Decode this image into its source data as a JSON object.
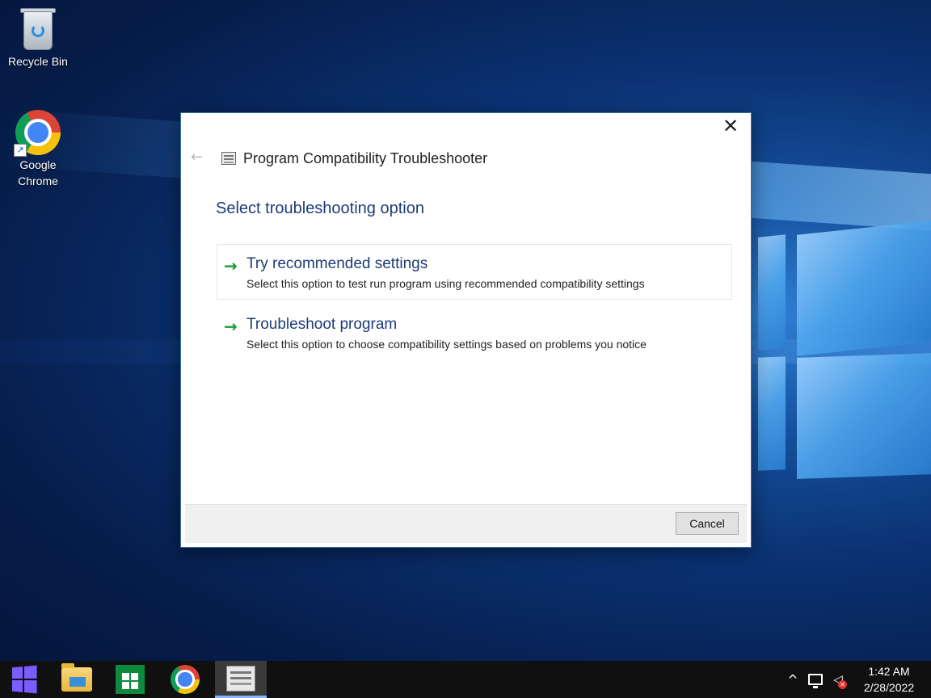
{
  "desktop": {
    "icons": [
      {
        "label": "Recycle Bin",
        "icon": "recycle-bin-icon"
      },
      {
        "label": "Google Chrome",
        "label_line1": "Google",
        "label_line2": "Chrome",
        "icon": "chrome-icon"
      }
    ]
  },
  "dialog": {
    "title": "Program Compatibility Troubleshooter",
    "back_icon": "←",
    "close_icon": "✕",
    "heading": "Select troubleshooting option",
    "options": [
      {
        "title": "Try recommended settings",
        "description": "Select this option to test run program using recommended compatibility settings",
        "icon": "→"
      },
      {
        "title": "Troubleshoot program",
        "description": "Select this option to choose compatibility settings based on problems you notice",
        "icon": "→"
      }
    ],
    "cancel_label": "Cancel"
  },
  "taskbar": {
    "items": [
      "start-button",
      "file-explorer",
      "microsoft-store",
      "google-chrome",
      "program-compatibility-troubleshooter"
    ],
    "tray": {
      "chevron": "^",
      "time": "1:42 AM",
      "date": "2/28/2022"
    }
  },
  "colors": {
    "heading": "#1e3b78",
    "arrow": "#17a02e",
    "taskbar": "#101010",
    "start_logo": "#7a5cff"
  }
}
